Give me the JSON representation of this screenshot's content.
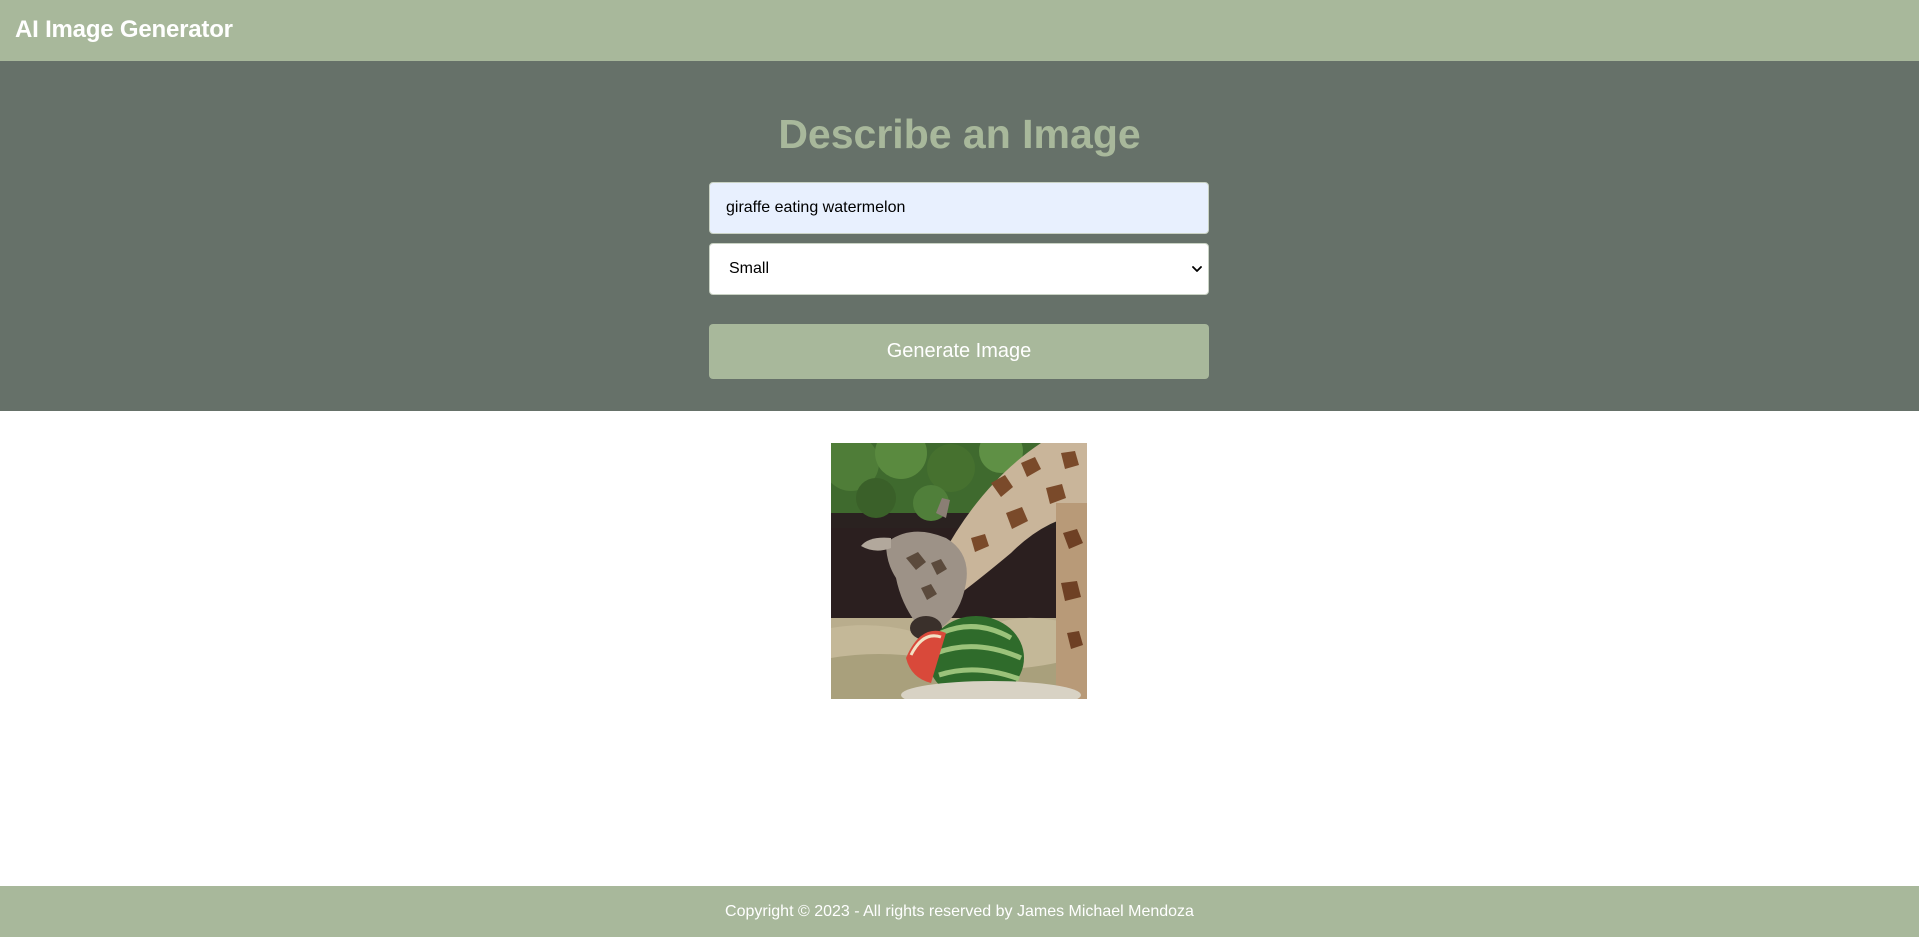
{
  "header": {
    "brand": "AI Image Generator"
  },
  "form": {
    "title": "Describe an Image",
    "prompt_value": "giraffe eating watermelon",
    "size_selected": "Small",
    "generate_label": "Generate Image"
  },
  "result": {
    "image_icon": "generated-image"
  },
  "footer": {
    "copyright": "Copyright © 2023 - All rights reserved by James Michael Mendoza"
  },
  "colors": {
    "accent": "#a8b89b",
    "hero_bg": "#667169",
    "input_bg": "#e8f0fe",
    "white": "#ffffff"
  }
}
